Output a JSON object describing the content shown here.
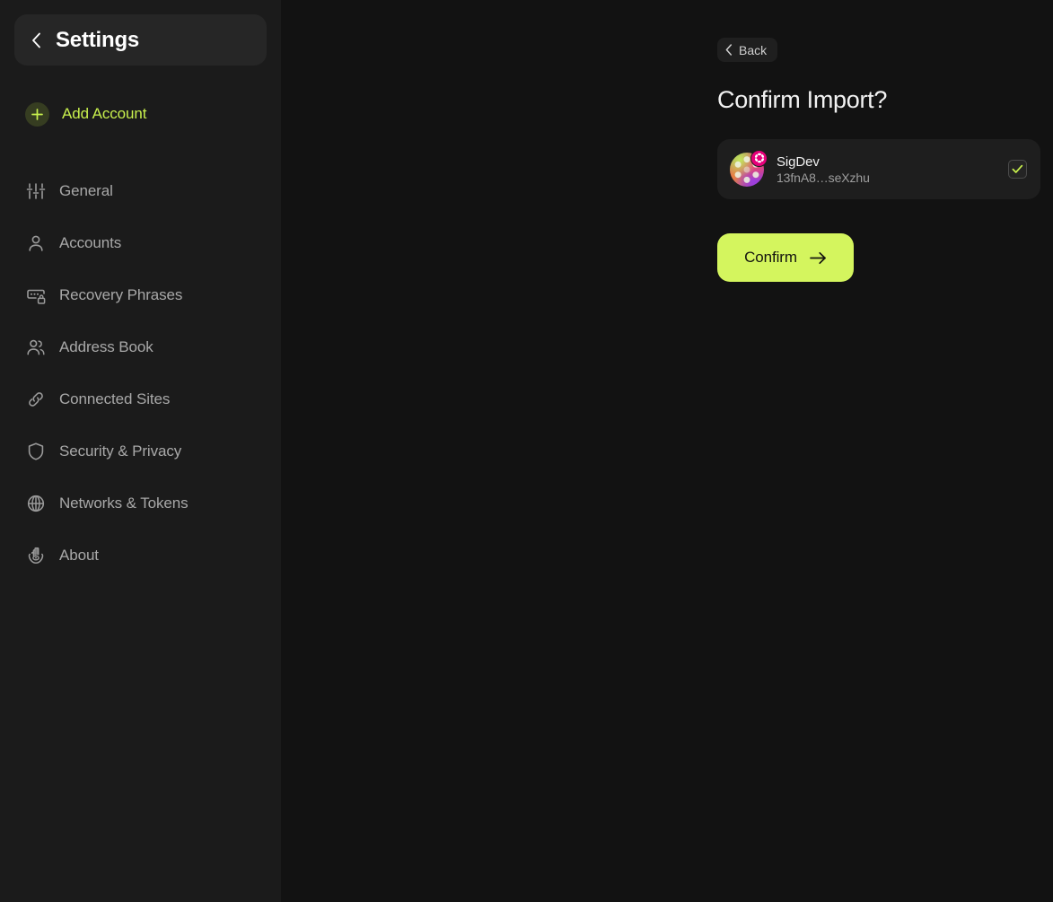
{
  "theme": {
    "app_background": "#121212",
    "sidebar_background": "#1b1b1b",
    "card_background": "#1e1e1e",
    "accent_lime": "#d4f55e",
    "accent_lime_text": "#c8f04d",
    "badge_pink": "#e6007a",
    "muted_text": "#a8a8a8"
  },
  "sidebar": {
    "header": {
      "title": "Settings",
      "back_icon": "chevron-left-icon"
    },
    "add_account": {
      "label": "Add Account",
      "icon": "plus-icon"
    },
    "items": [
      {
        "label": "General",
        "icon": "sliders-icon"
      },
      {
        "label": "Accounts",
        "icon": "user-icon"
      },
      {
        "label": "Recovery Phrases",
        "icon": "password-lock-icon"
      },
      {
        "label": "Address Book",
        "icon": "users-icon"
      },
      {
        "label": "Connected Sites",
        "icon": "link-icon"
      },
      {
        "label": "Security & Privacy",
        "icon": "shield-icon"
      },
      {
        "label": "Networks & Tokens",
        "icon": "globe-icon"
      },
      {
        "label": "About",
        "icon": "hamsa-hand-icon"
      }
    ]
  },
  "main": {
    "back_button": {
      "label": "Back",
      "icon": "chevron-left-icon"
    },
    "title": "Confirm Import?",
    "account": {
      "name": "SigDev",
      "address": "13fnA8…seXzhu",
      "avatar_icon": "identicon-avatar",
      "network_badge_icon": "polkadot-icon",
      "selected": true,
      "checkbox_icon": "check-icon"
    },
    "confirm_button": {
      "label": "Confirm",
      "icon": "arrow-right-icon"
    }
  }
}
